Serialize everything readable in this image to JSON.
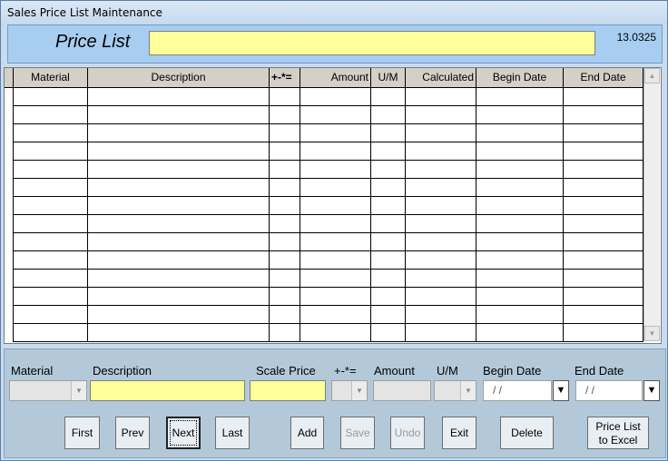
{
  "window": {
    "title": "Sales Price List Maintenance"
  },
  "header": {
    "label": "Price List",
    "value": "",
    "version": "13.0325"
  },
  "grid": {
    "columns": [
      "",
      "Material",
      "Description",
      "+-*=",
      "Amount",
      "U/M",
      "Calculated",
      "Begin Date",
      "End Date"
    ],
    "rows": [
      [],
      [],
      [],
      [],
      [],
      [],
      [],
      [],
      [],
      [],
      [],
      [],
      [],
      []
    ]
  },
  "form": {
    "labels": {
      "material": "Material",
      "description": "Description",
      "scale_price": "Scale Price",
      "op": "+-*=",
      "amount": "Amount",
      "um": "U/M",
      "begin_date": "Begin Date",
      "end_date": "End Date"
    },
    "values": {
      "material": "",
      "description": "",
      "scale_price": "",
      "op": "",
      "amount": "",
      "um": "",
      "begin_date": " /  /",
      "end_date": " /  /"
    }
  },
  "buttons": {
    "first": "First",
    "prev": "Prev",
    "next": "Next",
    "last": "Last",
    "add": "Add",
    "save": "Save",
    "undo": "Undo",
    "exit": "Exit",
    "delete": "Delete",
    "export_line1": "Price List",
    "export_line2": "to Excel"
  },
  "icons": {
    "combo_arrow": "chevron-down-icon",
    "date_drop": "triangle-down-icon",
    "scroll_up": "arrow-up-icon",
    "scroll_down": "arrow-down-icon"
  }
}
